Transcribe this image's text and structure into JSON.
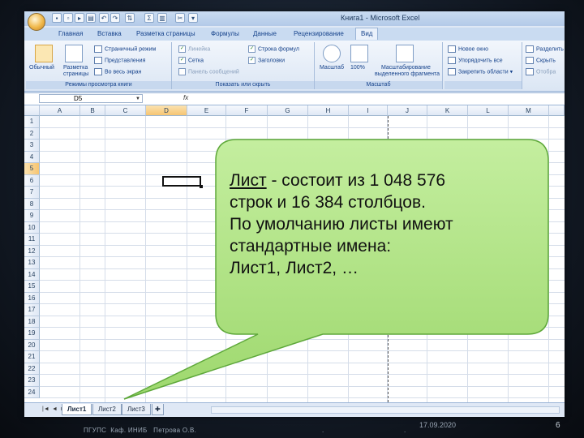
{
  "window": {
    "title": "Книга1 - Microsoft Excel"
  },
  "ribbon": {
    "tabs": [
      "Главная",
      "Вставка",
      "Разметка страницы",
      "Формулы",
      "Данные",
      "Рецензирование",
      "Вид"
    ],
    "active_tab": "Вид",
    "group_book_views": {
      "caption": "Режимы просмотра книги",
      "normal": "Обычный",
      "page_layout_line1": "Разметка",
      "page_layout_line2": "страницы",
      "page_mode": "Страничный режим",
      "views": "Представления",
      "full_screen": "Во весь экран"
    },
    "group_show_hide": {
      "caption": "Показать или скрыть",
      "ruler": "Линейка",
      "grid": "Сетка",
      "message_bar": "Панель сообщений",
      "formula_bar": "Строка формул",
      "headings": "Заголовки"
    },
    "group_zoom": {
      "caption": "Масштаб",
      "zoom": "Масштаб",
      "zoom100": "100%",
      "zoom_sel_line1": "Масштабирование",
      "zoom_sel_line2": "выделенного фрагмента"
    },
    "group_window": {
      "new_window": "Новое окно",
      "arrange_all": "Упорядочить все",
      "freeze": "Закрепить области",
      "split": "Разделить",
      "hide": "Скрыть",
      "unhide": "Отобра"
    }
  },
  "formula_bar": {
    "name_box": "D5",
    "fx": "fx"
  },
  "grid": {
    "columns": [
      "A",
      "B",
      "C",
      "D",
      "E",
      "F",
      "G",
      "H",
      "I",
      "J",
      "K",
      "L",
      "M"
    ],
    "rows": [
      "1",
      "2",
      "3",
      "4",
      "5",
      "6",
      "7",
      "8",
      "9",
      "10",
      "11",
      "12",
      "13",
      "14",
      "15",
      "16",
      "17",
      "18",
      "19",
      "20",
      "21",
      "22",
      "23",
      "24"
    ],
    "selected_column": "D",
    "selected_row": "5"
  },
  "sheets": {
    "tabs": [
      "Лист1",
      "Лист2",
      "Лист3"
    ],
    "active": "Лист1"
  },
  "callout": {
    "term": "Лист",
    "line1_rest": " - состоит из 1 048 576",
    "line2": "строк и 16 384 столбцов.",
    "line3": "По умолчанию листы имеют",
    "line4": "стандартные имена:",
    "line5": "Лист1, Лист2, …",
    "fill_color": "#a9e07c"
  },
  "footer": {
    "left": "ПГУПС  Каф. ИНИБ   Петрова О.В.",
    "dot1": ".",
    "dot2": ".",
    "date": "17.09.2020",
    "page": "6"
  }
}
